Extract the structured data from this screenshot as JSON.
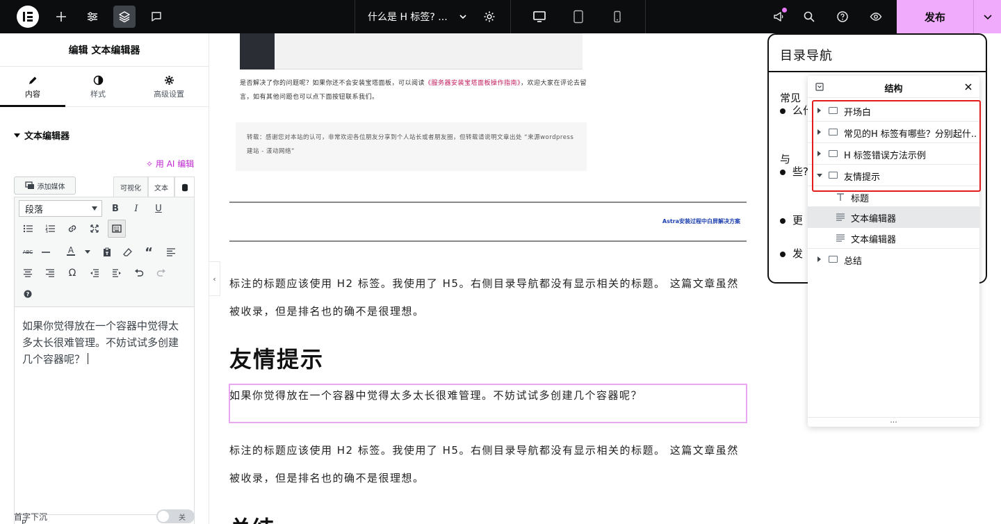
{
  "topbar": {
    "doc_title": "什么是 H 标签? ...",
    "publish_label": "发布"
  },
  "panel": {
    "header": "编辑 文本编辑器",
    "tabs": [
      {
        "label": "内容",
        "icon": "pencil-icon"
      },
      {
        "label": "样式",
        "icon": "half-circle-icon"
      },
      {
        "label": "高级设置",
        "icon": "gear-icon"
      }
    ],
    "section_title": "文本编辑器",
    "ai_edit": "用 AI 编辑",
    "add_media": "添加媒体",
    "mode_visual": "可视化",
    "mode_text": "文本",
    "paragraph_select": "段落",
    "editor_content": "如果你觉得放在一个容器中觉得太多太长很难管理。不妨试试多创建几个容器呢？",
    "status_path": "P",
    "dropcap_label": "首字下沉",
    "dropcap_toggle": "关"
  },
  "canvas": {
    "small_para_1": "是否解决了你的问题呢？如果你还不会安装宝塔面板，可以阅读",
    "small_link": "《服务器安装宝塔面板操作指南》",
    "small_para_2": "，欢迎大家在评论去留言，如有其他问题也可以点下面按钮联系我们。",
    "quote": "转载：感谢您对本站的认可，非常欢迎各位朋友分享到个人站长或者朋友圈，但转载请说明文章出处 “来源wordpress建站 - 漾动网络”",
    "astra_link": "Astra安装过程中白屏解决方案",
    "para_1": "标注的标题应该使用 H2 标签。我使用了 H5。右侧目录导航都没有显示相关的标题。 这篇文章虽然被收录，但是排名也的确不是很理想。",
    "heading_1": "友情提示",
    "selected_text": "如果你觉得放在一个容器中觉得太多太长很难管理。不妨试试多创建几个容器呢？",
    "para_2": "标注的标题应该使用 H2 标签。我使用了 H5。右侧目录导航都没有显示相关的标题。 这篇文章虽然被收录，但是排名也的确不是很理想。",
    "heading_2": "总结"
  },
  "toc": {
    "title": "目录导航",
    "items": [
      "常见",
      "么什",
      "与",
      "些?",
      "更",
      "发"
    ]
  },
  "structure": {
    "title": "结构",
    "rows": [
      {
        "label": "开场白"
      },
      {
        "label": "常见的H 标签有哪些？分别起什..."
      },
      {
        "label": "H 标签错误方法示例"
      },
      {
        "label": "友情提示"
      },
      {
        "label": "标题"
      },
      {
        "label": "文本编辑器"
      },
      {
        "label": "文本编辑器"
      },
      {
        "label": "总结"
      }
    ],
    "more": "..."
  },
  "colors": {
    "accent_pink": "#f0abfc",
    "selection_border": "#e8a7f0",
    "highlight_red": "#e21b1b",
    "ai_magenta": "#c026d3"
  }
}
